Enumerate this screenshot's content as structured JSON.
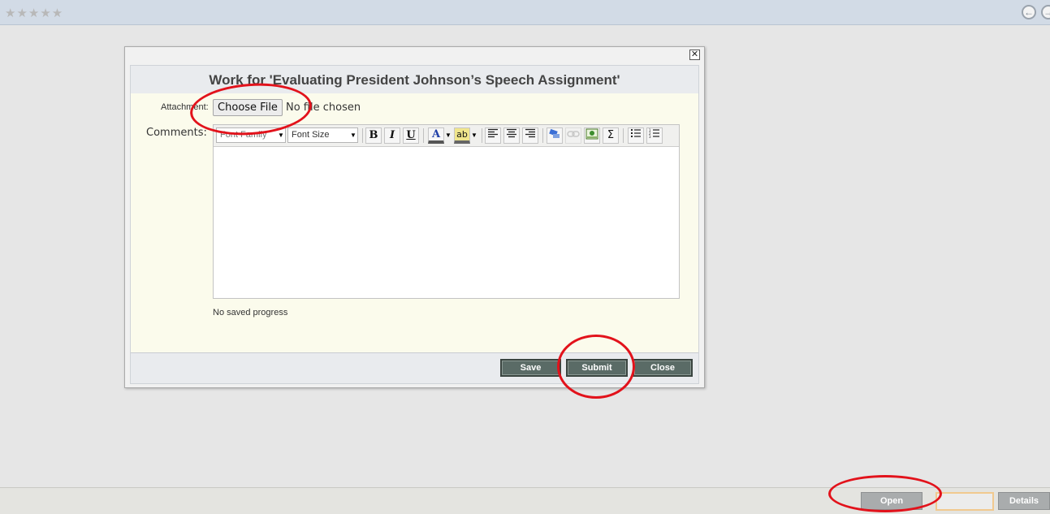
{
  "topbar": {
    "stars": "★★★★★"
  },
  "dialog": {
    "close_glyph": "✕",
    "title": "Work for 'Evaluating President Johnson’s Speech Assignment'",
    "attachment_label": "Attachment:",
    "choose_file_label": "Choose File",
    "no_file_text": "No file chosen",
    "comments_label": "Comments:",
    "editor": {
      "font_family_placeholder": "Font Family",
      "font_size_placeholder": "Font Size",
      "bold": "B",
      "italic": "I",
      "underline": "U",
      "text_color": "A",
      "highlight": "ab",
      "sigma": "Σ"
    },
    "saved_status": "No saved progress",
    "buttons": {
      "save": "Save",
      "submit": "Submit",
      "close": "Close"
    }
  },
  "footer": {
    "open": "Open",
    "details": "Details"
  },
  "colors": {
    "annotation": "#e2121b",
    "dialog_button": "#5a6b66",
    "footer_button": "#a9acad"
  }
}
